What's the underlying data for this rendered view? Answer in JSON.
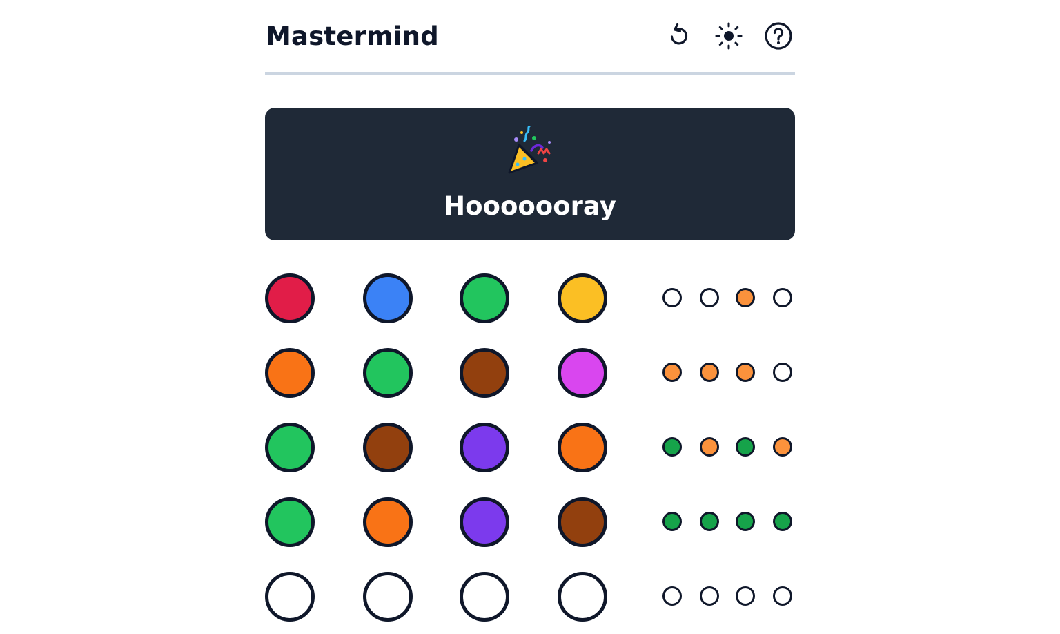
{
  "app": {
    "title": "Mastermind"
  },
  "header": {
    "buttons": [
      {
        "name": "restart-button",
        "icon": "restart-icon"
      },
      {
        "name": "theme-toggle-button",
        "icon": "sun-icon"
      },
      {
        "name": "help-button",
        "icon": "question-circle-icon"
      }
    ]
  },
  "result": {
    "icon": "party-popper-icon",
    "message": "Hooooooray"
  },
  "colors": {
    "red": "#e11d48",
    "blue": "#3b82f6",
    "green": "#22c55e",
    "yellow": "#fbbf24",
    "orange": "#f97316",
    "brown": "#92400e",
    "magenta": "#d946ef",
    "violet": "#7c3aed",
    "empty": "#ffffff",
    "hint_correct_position": "#16a34a",
    "hint_correct_color": "#fb923c",
    "hint_empty": "#ffffff",
    "outline": "#0f172a",
    "banner_bg": "#1f2937",
    "divider": "#cbd5e1"
  },
  "board": {
    "rows": [
      {
        "guess": [
          "red",
          "blue",
          "green",
          "yellow"
        ],
        "hints": [
          "empty",
          "empty",
          "color",
          "empty"
        ]
      },
      {
        "guess": [
          "orange",
          "green",
          "brown",
          "magenta"
        ],
        "hints": [
          "color",
          "color",
          "color",
          "empty"
        ]
      },
      {
        "guess": [
          "green",
          "brown",
          "violet",
          "orange"
        ],
        "hints": [
          "position",
          "color",
          "position",
          "color"
        ]
      },
      {
        "guess": [
          "green",
          "orange",
          "violet",
          "brown"
        ],
        "hints": [
          "position",
          "position",
          "position",
          "position"
        ]
      },
      {
        "guess": [
          "empty",
          "empty",
          "empty",
          "empty"
        ],
        "hints": [
          "empty",
          "empty",
          "empty",
          "empty"
        ]
      }
    ]
  }
}
